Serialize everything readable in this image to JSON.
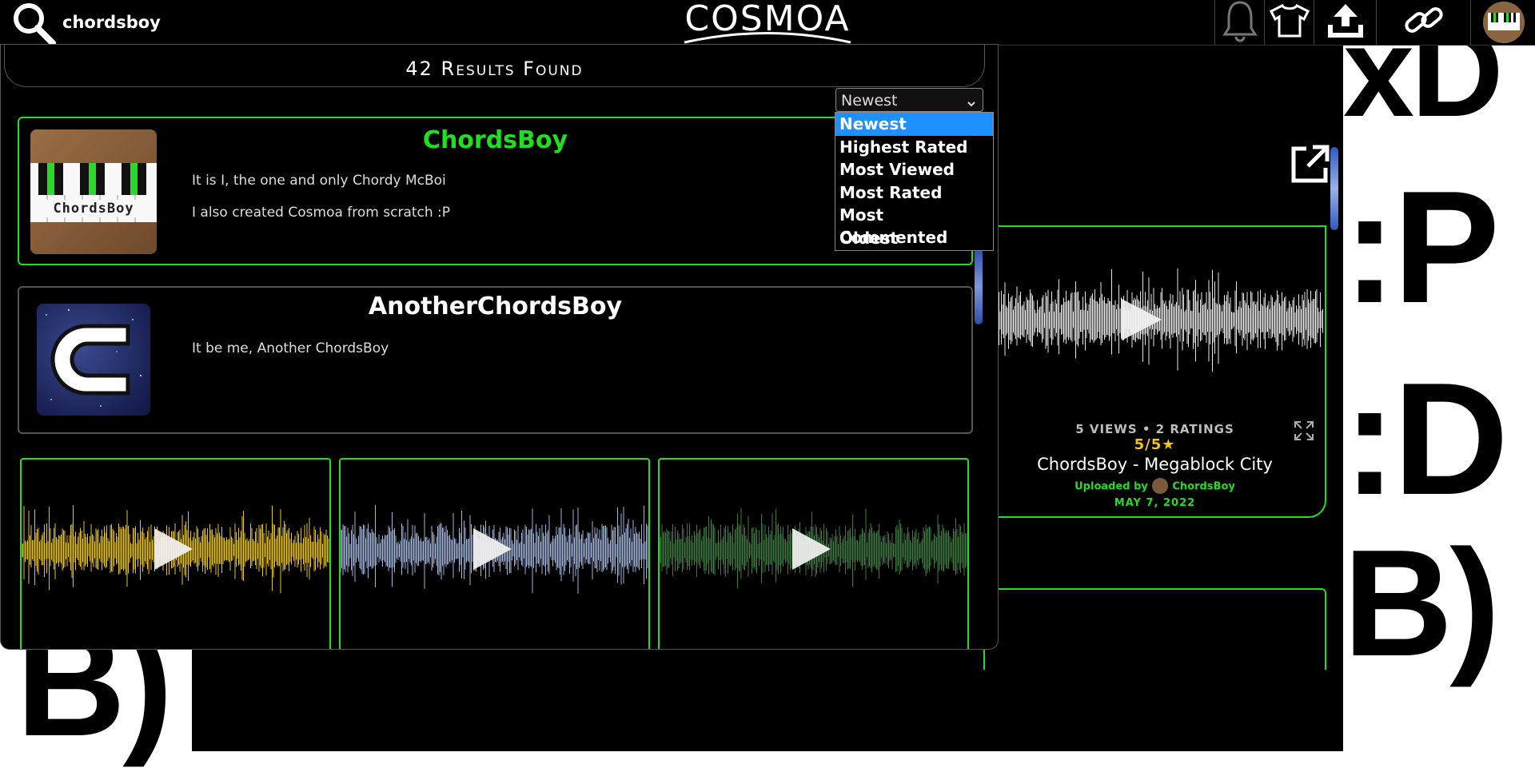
{
  "search": {
    "query": "chordsboy"
  },
  "logo": {
    "text": "COSMOA"
  },
  "toolbar": {
    "icons": [
      "bell-icon",
      "shirt-icon",
      "upload-icon",
      "link-icon",
      "avatar"
    ]
  },
  "background": {
    "right_faces": [
      "xD",
      ":P",
      ":D",
      "B)"
    ],
    "left_face": "B)"
  },
  "feed": {
    "card": {
      "stats": "5 VIEWS • 2 RATINGS",
      "rating": "5/5★",
      "title": "ChordsBoy - Megablock City",
      "uploaded_by_label": "Uploaded by",
      "uploader": "ChordsBoy",
      "date": "MAY 7, 2022"
    }
  },
  "results": {
    "header": "42 Results Found",
    "sort": {
      "selected": "Newest",
      "options": [
        "Newest",
        "Highest Rated",
        "Most Viewed",
        "Most Rated",
        "Most Commented",
        "Oldest"
      ]
    },
    "users": [
      {
        "name": "ChordsBoy",
        "bio": [
          "It is I, the one and only Chordy McBoi",
          "I also created Cosmoa from scratch :P"
        ],
        "avatar_text": "ChordsBoy"
      },
      {
        "name": "AnotherChordsBoy",
        "bio": [
          "It be me, Another ChordsBoy"
        ]
      }
    ]
  },
  "colors": {
    "accent_green": "#1ee01e",
    "select_highlight": "#1e90ff",
    "rating_gold": "#f2c21b",
    "waveform_1": "#e8c31d",
    "waveform_2": "#9fb4d8",
    "waveform_3": "#3f7a45",
    "waveform_feed": "#e6e6e6"
  }
}
